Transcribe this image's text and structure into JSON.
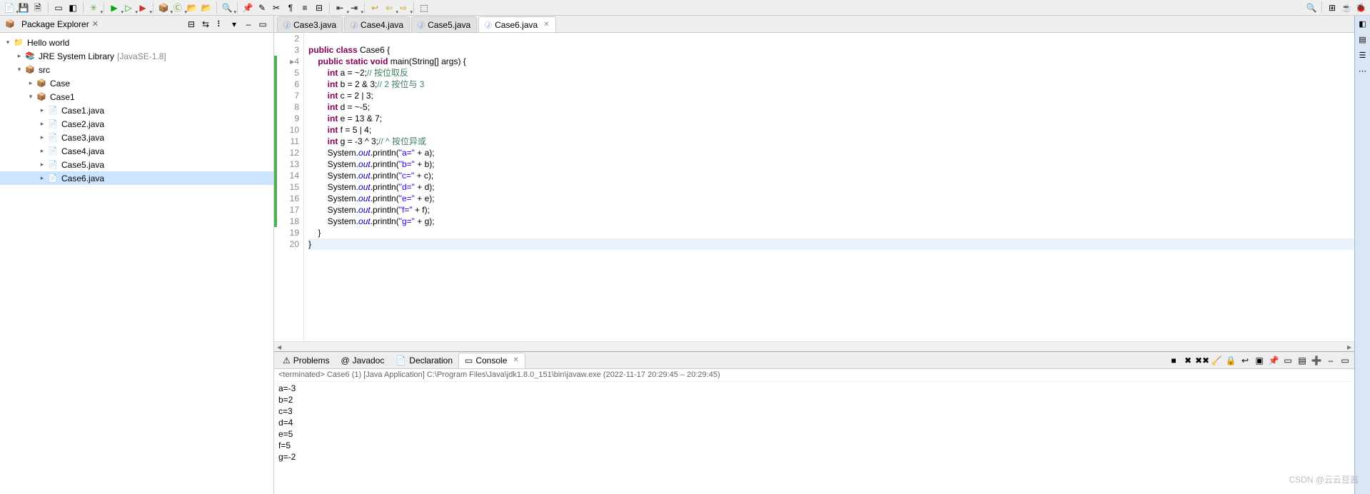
{
  "toolbar": {
    "buttons": [
      "new",
      "save",
      "save-all",
      "print",
      "build",
      "toggle",
      "skip",
      "debug",
      "run",
      "coverage",
      "ext-tools",
      "new-pkg",
      "new-class",
      "open-type",
      "search-dlg",
      "task",
      "fwd",
      "pin",
      "edit",
      "cut",
      "para",
      "align",
      "list",
      "outdent",
      "indent",
      "nav-back",
      "nav-fwd",
      "step",
      "arrow",
      "perspective"
    ]
  },
  "toolbar_right": {
    "buttons": [
      "search",
      "open-perspective",
      "java-perspective",
      "debug-perspective"
    ]
  },
  "packageExplorer": {
    "title": "Package Explorer",
    "mini_buttons": [
      "collapse-all-icon",
      "link-editor-icon",
      "view-menu-icon",
      "filter-icon",
      "minimize-icon",
      "maximize-icon"
    ],
    "tree": {
      "project": {
        "label": "Hello world",
        "expanded": true
      },
      "jre": {
        "label": "JRE System Library",
        "suffix": "[JavaSE-1.8]"
      },
      "src": {
        "label": "src",
        "expanded": true
      },
      "pkg_case": {
        "label": "Case"
      },
      "pkg_case1": {
        "label": "Case1",
        "expanded": true
      },
      "files": [
        {
          "label": "Case1.java"
        },
        {
          "label": "Case2.java"
        },
        {
          "label": "Case3.java"
        },
        {
          "label": "Case4.java"
        },
        {
          "label": "Case5.java"
        },
        {
          "label": "Case6.java",
          "selected": true
        }
      ]
    }
  },
  "editor": {
    "tabs": [
      {
        "label": "Case3.java",
        "active": false
      },
      {
        "label": "Case4.java",
        "active": false
      },
      {
        "label": "Case5.java",
        "active": false
      },
      {
        "label": "Case6.java",
        "active": true
      }
    ],
    "lines": [
      {
        "n": 2,
        "cov": false,
        "html": ""
      },
      {
        "n": 3,
        "cov": false,
        "html": "<span class='kw'>public</span> <span class='kw'>class</span> Case6 {"
      },
      {
        "n": 4,
        "cov": true,
        "html": "    <span class='kw'>public</span> <span class='kw'>static</span> <span class='kw'>void</span> main(String[] args) {",
        "ann": "▸"
      },
      {
        "n": 5,
        "cov": true,
        "html": "        <span class='kw'>int</span> a = ~2;<span class='cm'>// 按位取反</span>"
      },
      {
        "n": 6,
        "cov": true,
        "html": "        <span class='kw'>int</span> b = 2 &amp; 3;<span class='cm'>// 2 按位与 3</span>"
      },
      {
        "n": 7,
        "cov": true,
        "html": "        <span class='kw'>int</span> c = 2 | 3;"
      },
      {
        "n": 8,
        "cov": true,
        "html": "        <span class='kw'>int</span> d = ~-5;"
      },
      {
        "n": 9,
        "cov": true,
        "html": "        <span class='kw'>int</span> e = 13 &amp; 7;"
      },
      {
        "n": 10,
        "cov": true,
        "html": "        <span class='kw'>int</span> f = 5 | 4;"
      },
      {
        "n": 11,
        "cov": true,
        "html": "        <span class='kw'>int</span> g = -3 ^ 3;<span class='cm'>// ^ 按位异或</span>"
      },
      {
        "n": 12,
        "cov": true,
        "html": "        System.<span class='fld'>out</span>.println(<span class='st'>\"a=\"</span> + a);"
      },
      {
        "n": 13,
        "cov": true,
        "html": "        System.<span class='fld'>out</span>.println(<span class='st'>\"b=\"</span> + b);"
      },
      {
        "n": 14,
        "cov": true,
        "html": "        System.<span class='fld'>out</span>.println(<span class='st'>\"c=\"</span> + c);"
      },
      {
        "n": 15,
        "cov": true,
        "html": "        System.<span class='fld'>out</span>.println(<span class='st'>\"d=\"</span> + d);"
      },
      {
        "n": 16,
        "cov": true,
        "html": "        System.<span class='fld'>out</span>.println(<span class='st'>\"e=\"</span> + e);"
      },
      {
        "n": 17,
        "cov": true,
        "html": "        System.<span class='fld'>out</span>.println(<span class='st'>\"f=\"</span> + f);"
      },
      {
        "n": 18,
        "cov": true,
        "html": "        System.<span class='fld'>out</span>.println(<span class='st'>\"g=\"</span> + g);"
      },
      {
        "n": 19,
        "cov": false,
        "html": "    }"
      },
      {
        "n": 20,
        "cov": false,
        "html": "}",
        "hl": true
      }
    ]
  },
  "bottom": {
    "tabs": [
      {
        "label": "Problems",
        "icon": "⚠",
        "active": false
      },
      {
        "label": "Javadoc",
        "icon": "@",
        "active": false
      },
      {
        "label": "Declaration",
        "icon": "📄",
        "active": false
      },
      {
        "label": "Console",
        "icon": "▭",
        "active": true
      }
    ],
    "toolbar_icons": [
      "terminate-icon",
      "remove-icon",
      "remove-all-icon",
      "clear-icon",
      "scroll-lock-icon",
      "word-wrap-icon",
      "show-console-icon",
      "pin-console-icon",
      "display-icon",
      "open-console-icon",
      "new-console-icon",
      "minimize-icon",
      "maximize-icon"
    ],
    "status": "<terminated> Case6 (1) [Java Application] C:\\Program Files\\Java\\jdk1.8.0_151\\bin\\javaw.exe  (2022-11-17 20:29:45 – 20:29:45)",
    "output": [
      "a=-3",
      "b=2",
      "c=3",
      "d=4",
      "e=5",
      "f=5",
      "g=-2"
    ]
  },
  "watermark": "CSDN @云云豆酱"
}
